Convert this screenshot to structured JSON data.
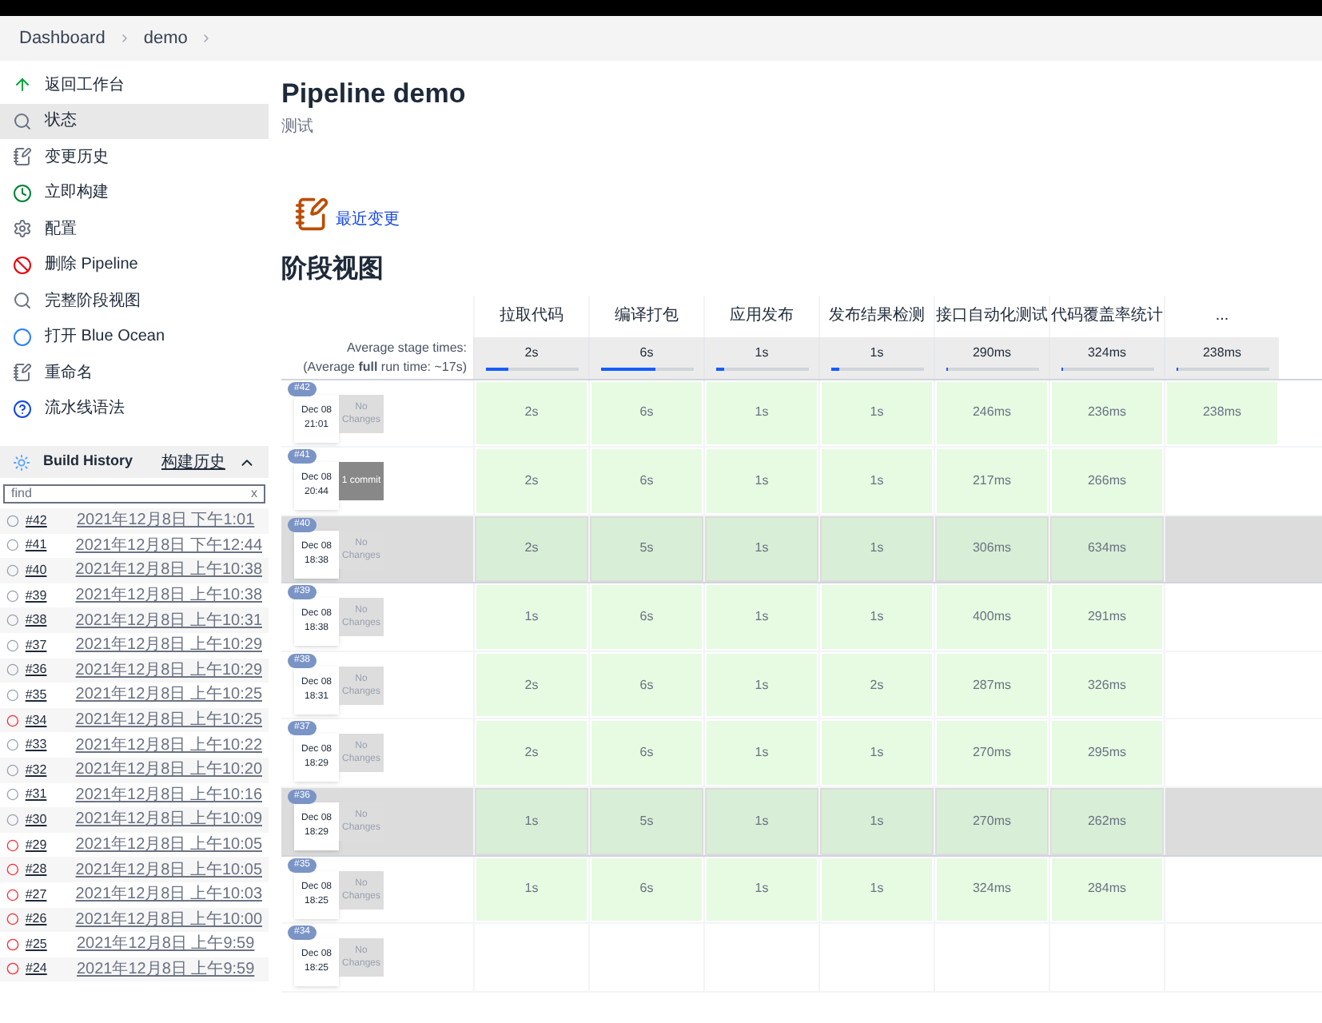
{
  "breadcrumbs": [
    "Dashboard",
    "demo"
  ],
  "sidebar": {
    "items": [
      {
        "label": "返回工作台",
        "selected": false
      },
      {
        "label": "状态",
        "selected": true
      },
      {
        "label": "变更历史",
        "selected": false
      },
      {
        "label": "立即构建",
        "selected": false
      },
      {
        "label": "配置",
        "selected": false
      },
      {
        "label": "删除 Pipeline",
        "selected": false
      },
      {
        "label": "完整阶段视图",
        "selected": false
      },
      {
        "label": "打开 Blue Ocean",
        "selected": false
      },
      {
        "label": "重命名",
        "selected": false
      },
      {
        "label": "流水线语法",
        "selected": false
      }
    ]
  },
  "build_history": {
    "title": "Build History",
    "link": "构建历史",
    "search": {
      "value": "find",
      "clear": "x"
    },
    "builds": [
      {
        "number": "#42",
        "time": "2021年12月8日 下午1:01",
        "failed": false
      },
      {
        "number": "#41",
        "time": "2021年12月8日 下午12:44",
        "failed": false
      },
      {
        "number": "#40",
        "time": "2021年12月8日 上午10:38",
        "failed": false
      },
      {
        "number": "#39",
        "time": "2021年12月8日 上午10:38",
        "failed": false
      },
      {
        "number": "#38",
        "time": "2021年12月8日 上午10:31",
        "failed": false
      },
      {
        "number": "#37",
        "time": "2021年12月8日 上午10:29",
        "failed": false
      },
      {
        "number": "#36",
        "time": "2021年12月8日 上午10:29",
        "failed": false
      },
      {
        "number": "#35",
        "time": "2021年12月8日 上午10:25",
        "failed": false
      },
      {
        "number": "#34",
        "time": "2021年12月8日 上午10:25",
        "failed": true
      },
      {
        "number": "#33",
        "time": "2021年12月8日 上午10:22",
        "failed": false
      },
      {
        "number": "#32",
        "time": "2021年12月8日 上午10:20",
        "failed": false
      },
      {
        "number": "#31",
        "time": "2021年12月8日 上午10:16",
        "failed": false
      },
      {
        "number": "#30",
        "time": "2021年12月8日 上午10:09",
        "failed": false
      },
      {
        "number": "#29",
        "time": "2021年12月8日 上午10:05",
        "failed": true
      },
      {
        "number": "#28",
        "time": "2021年12月8日 上午10:05",
        "failed": true
      },
      {
        "number": "#27",
        "time": "2021年12月8日 上午10:03",
        "failed": true
      },
      {
        "number": "#26",
        "time": "2021年12月8日 上午10:00",
        "failed": true
      },
      {
        "number": "#25",
        "time": "2021年12月8日 上午9:59",
        "failed": true
      },
      {
        "number": "#24",
        "time": "2021年12月8日 上午9:59",
        "failed": true
      }
    ]
  },
  "page": {
    "title": "Pipeline demo",
    "description": "测试",
    "recent_changes": "最近变更",
    "stage_view_title": "阶段视图"
  },
  "stage_view": {
    "average_label": "Average stage times:",
    "average_note": "(Average **full** run time: ~17s)",
    "stages": [
      {
        "name": "拉取代码",
        "average": "2s",
        "level": 0.25
      },
      {
        "name": "编译打包",
        "average": "6s",
        "level": 0.6
      },
      {
        "name": "应用发布",
        "average": "1s",
        "level": 0.1
      },
      {
        "name": "发布结果检测",
        "average": "1s",
        "level": 0.1
      },
      {
        "name": "接口自动化测试",
        "average": "290ms",
        "level": 0.03
      },
      {
        "name": "代码覆盖率统计",
        "average": "324ms",
        "level": 0.03
      },
      {
        "name": "...",
        "average": "238ms",
        "level": 0.03
      }
    ],
    "runs": [
      {
        "number": "#42",
        "date": "Dec 08",
        "time": "21:01",
        "changes": "No Changes",
        "has_commits": false,
        "highlighted": false,
        "cells": [
          "2s",
          "6s",
          "1s",
          "1s",
          "246ms",
          "236ms",
          "238ms"
        ]
      },
      {
        "number": "#41",
        "date": "Dec 08",
        "time": "20:44",
        "changes": "1 commit",
        "has_commits": true,
        "highlighted": false,
        "cells": [
          "2s",
          "6s",
          "1s",
          "1s",
          "217ms",
          "266ms",
          null
        ]
      },
      {
        "number": "#40",
        "date": "Dec 08",
        "time": "18:38",
        "changes": "No Changes",
        "has_commits": false,
        "highlighted": true,
        "cells": [
          "2s",
          "5s",
          "1s",
          "1s",
          "306ms",
          "634ms",
          null
        ]
      },
      {
        "number": "#39",
        "date": "Dec 08",
        "time": "18:38",
        "changes": "No Changes",
        "has_commits": false,
        "highlighted": false,
        "cells": [
          "1s",
          "6s",
          "1s",
          "1s",
          "400ms",
          "291ms",
          null
        ]
      },
      {
        "number": "#38",
        "date": "Dec 08",
        "time": "18:31",
        "changes": "No Changes",
        "has_commits": false,
        "highlighted": false,
        "cells": [
          "2s",
          "6s",
          "1s",
          "2s",
          "287ms",
          "326ms",
          null
        ]
      },
      {
        "number": "#37",
        "date": "Dec 08",
        "time": "18:29",
        "changes": "No Changes",
        "has_commits": false,
        "highlighted": false,
        "cells": [
          "2s",
          "6s",
          "1s",
          "1s",
          "270ms",
          "295ms",
          null
        ]
      },
      {
        "number": "#36",
        "date": "Dec 08",
        "time": "18:29",
        "changes": "No Changes",
        "has_commits": false,
        "highlighted": true,
        "cells": [
          "1s",
          "5s",
          "1s",
          "1s",
          "270ms",
          "262ms",
          null
        ]
      },
      {
        "number": "#35",
        "date": "Dec 08",
        "time": "18:25",
        "changes": "No Changes",
        "has_commits": false,
        "highlighted": false,
        "cells": [
          "1s",
          "6s",
          "1s",
          "1s",
          "324ms",
          "284ms",
          null
        ]
      },
      {
        "number": "#34",
        "date": "Dec 08",
        "time": "18:25",
        "changes": "No Changes",
        "has_commits": false,
        "highlighted": false,
        "cells": [
          null,
          null,
          null,
          null,
          null,
          null,
          null
        ]
      }
    ]
  }
}
